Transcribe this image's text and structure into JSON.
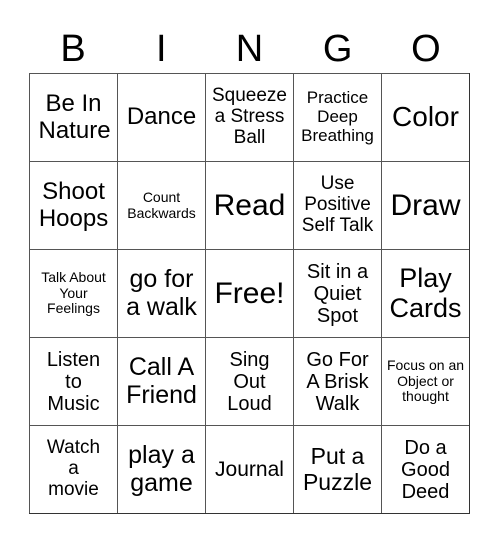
{
  "header": {
    "letters": [
      "B",
      "I",
      "N",
      "G",
      "O"
    ]
  },
  "cells": [
    [
      "Be In Nature",
      "Dance",
      "Squeeze a Stress Ball",
      "Practice Deep Breathing",
      "Color"
    ],
    [
      "Shoot Hoops",
      "Count Backwards",
      "Read",
      "Use Positive Self Talk",
      "Draw"
    ],
    [
      "Talk About Your Feelings",
      "go for a walk",
      "Free!",
      "Sit in a Quiet Spot",
      "Play Cards"
    ],
    [
      "Listen to Music",
      "Call A Friend",
      "Sing Out Loud",
      "Go For A Brisk Walk",
      "Focus on an Object or thought"
    ],
    [
      "Watch a movie",
      "play a game",
      "Journal",
      "Put a Puzzle",
      "Do a Good Deed"
    ]
  ]
}
